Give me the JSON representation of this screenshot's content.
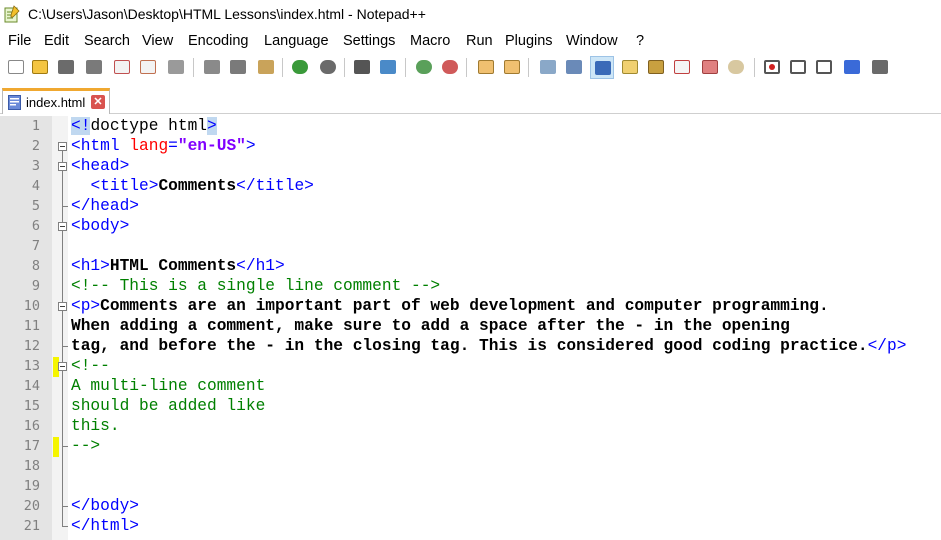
{
  "window": {
    "title": "C:\\Users\\Jason\\Desktop\\HTML Lessons\\index.html - Notepad++"
  },
  "menu": [
    "File",
    "Edit",
    "Search",
    "View",
    "Encoding",
    "Language",
    "Settings",
    "Macro",
    "Run",
    "Plugins",
    "Window",
    "?"
  ],
  "toolbar": {
    "buttons": [
      "new-file",
      "open-file",
      "save",
      "save-all",
      "close",
      "close-all",
      "print",
      "cut",
      "copy",
      "paste",
      "undo",
      "redo",
      "find",
      "replace",
      "zoom-in",
      "zoom-out",
      "sync-vertical",
      "sync-horizontal",
      "word-wrap",
      "show-all-chars",
      "indent-guide",
      "user-defined-language",
      "doc-map",
      "function-list",
      "folder-workspace",
      "monitoring",
      "record-macro",
      "stop-recording",
      "play-macro",
      "run-macro-multiple",
      "save-macro"
    ]
  },
  "tabs": [
    {
      "label": "index.html",
      "close": "✕"
    }
  ],
  "editor": {
    "line_numbers": [
      "1",
      "2",
      "3",
      "4",
      "5",
      "6",
      "7",
      "8",
      "9",
      "10",
      "11",
      "12",
      "13",
      "14",
      "15",
      "16",
      "17",
      "18",
      "19",
      "20",
      "21"
    ],
    "lines": [
      {
        "segments": [
          {
            "t": "<!",
            "c": "tag hl"
          },
          {
            "t": "doctype html",
            "c": "txt-plain"
          },
          {
            "t": ">",
            "c": "tag hl"
          }
        ]
      },
      {
        "segments": [
          {
            "t": "<html ",
            "c": "tag"
          },
          {
            "t": "lang",
            "c": "attr"
          },
          {
            "t": "=",
            "c": "tag"
          },
          {
            "t": "\"en-US\"",
            "c": "str"
          },
          {
            "t": ">",
            "c": "tag"
          }
        ]
      },
      {
        "segments": [
          {
            "t": "<head>",
            "c": "tag"
          }
        ]
      },
      {
        "segments": [
          {
            "t": "  ",
            "c": ""
          },
          {
            "t": "<title>",
            "c": "tag"
          },
          {
            "t": "Comments",
            "c": "txt"
          },
          {
            "t": "</title>",
            "c": "tag"
          }
        ]
      },
      {
        "segments": [
          {
            "t": "</head>",
            "c": "tag"
          }
        ]
      },
      {
        "segments": [
          {
            "t": "<body>",
            "c": "tag"
          }
        ]
      },
      {
        "segments": []
      },
      {
        "segments": [
          {
            "t": "<h1>",
            "c": "tag"
          },
          {
            "t": "HTML Comments",
            "c": "txt"
          },
          {
            "t": "</h1>",
            "c": "tag"
          }
        ]
      },
      {
        "segments": [
          {
            "t": "<!-- This is a single line comment -->",
            "c": "cmt"
          }
        ]
      },
      {
        "segments": [
          {
            "t": "<p>",
            "c": "tag"
          },
          {
            "t": "Comments are an important part of web development and computer programming.",
            "c": "txt"
          }
        ]
      },
      {
        "segments": [
          {
            "t": "When adding a comment, make sure to add a space after the - in the opening",
            "c": "txt"
          }
        ]
      },
      {
        "segments": [
          {
            "t": "tag, and before the - in the closing tag. This is considered good coding practice.",
            "c": "txt"
          },
          {
            "t": "</p>",
            "c": "tag"
          }
        ]
      },
      {
        "segments": [
          {
            "t": "<!--",
            "c": "cmt"
          }
        ]
      },
      {
        "segments": [
          {
            "t": "A multi-line comment",
            "c": "cmt"
          }
        ]
      },
      {
        "segments": [
          {
            "t": "should be added like",
            "c": "cmt"
          }
        ]
      },
      {
        "segments": [
          {
            "t": "this.",
            "c": "cmt"
          }
        ]
      },
      {
        "segments": [
          {
            "t": "-->",
            "c": "cmt"
          }
        ]
      },
      {
        "segments": []
      },
      {
        "segments": []
      },
      {
        "segments": [
          {
            "t": "</body>",
            "c": "tag"
          }
        ]
      },
      {
        "segments": [
          {
            "t": "</html>",
            "c": "tag"
          }
        ]
      }
    ]
  }
}
